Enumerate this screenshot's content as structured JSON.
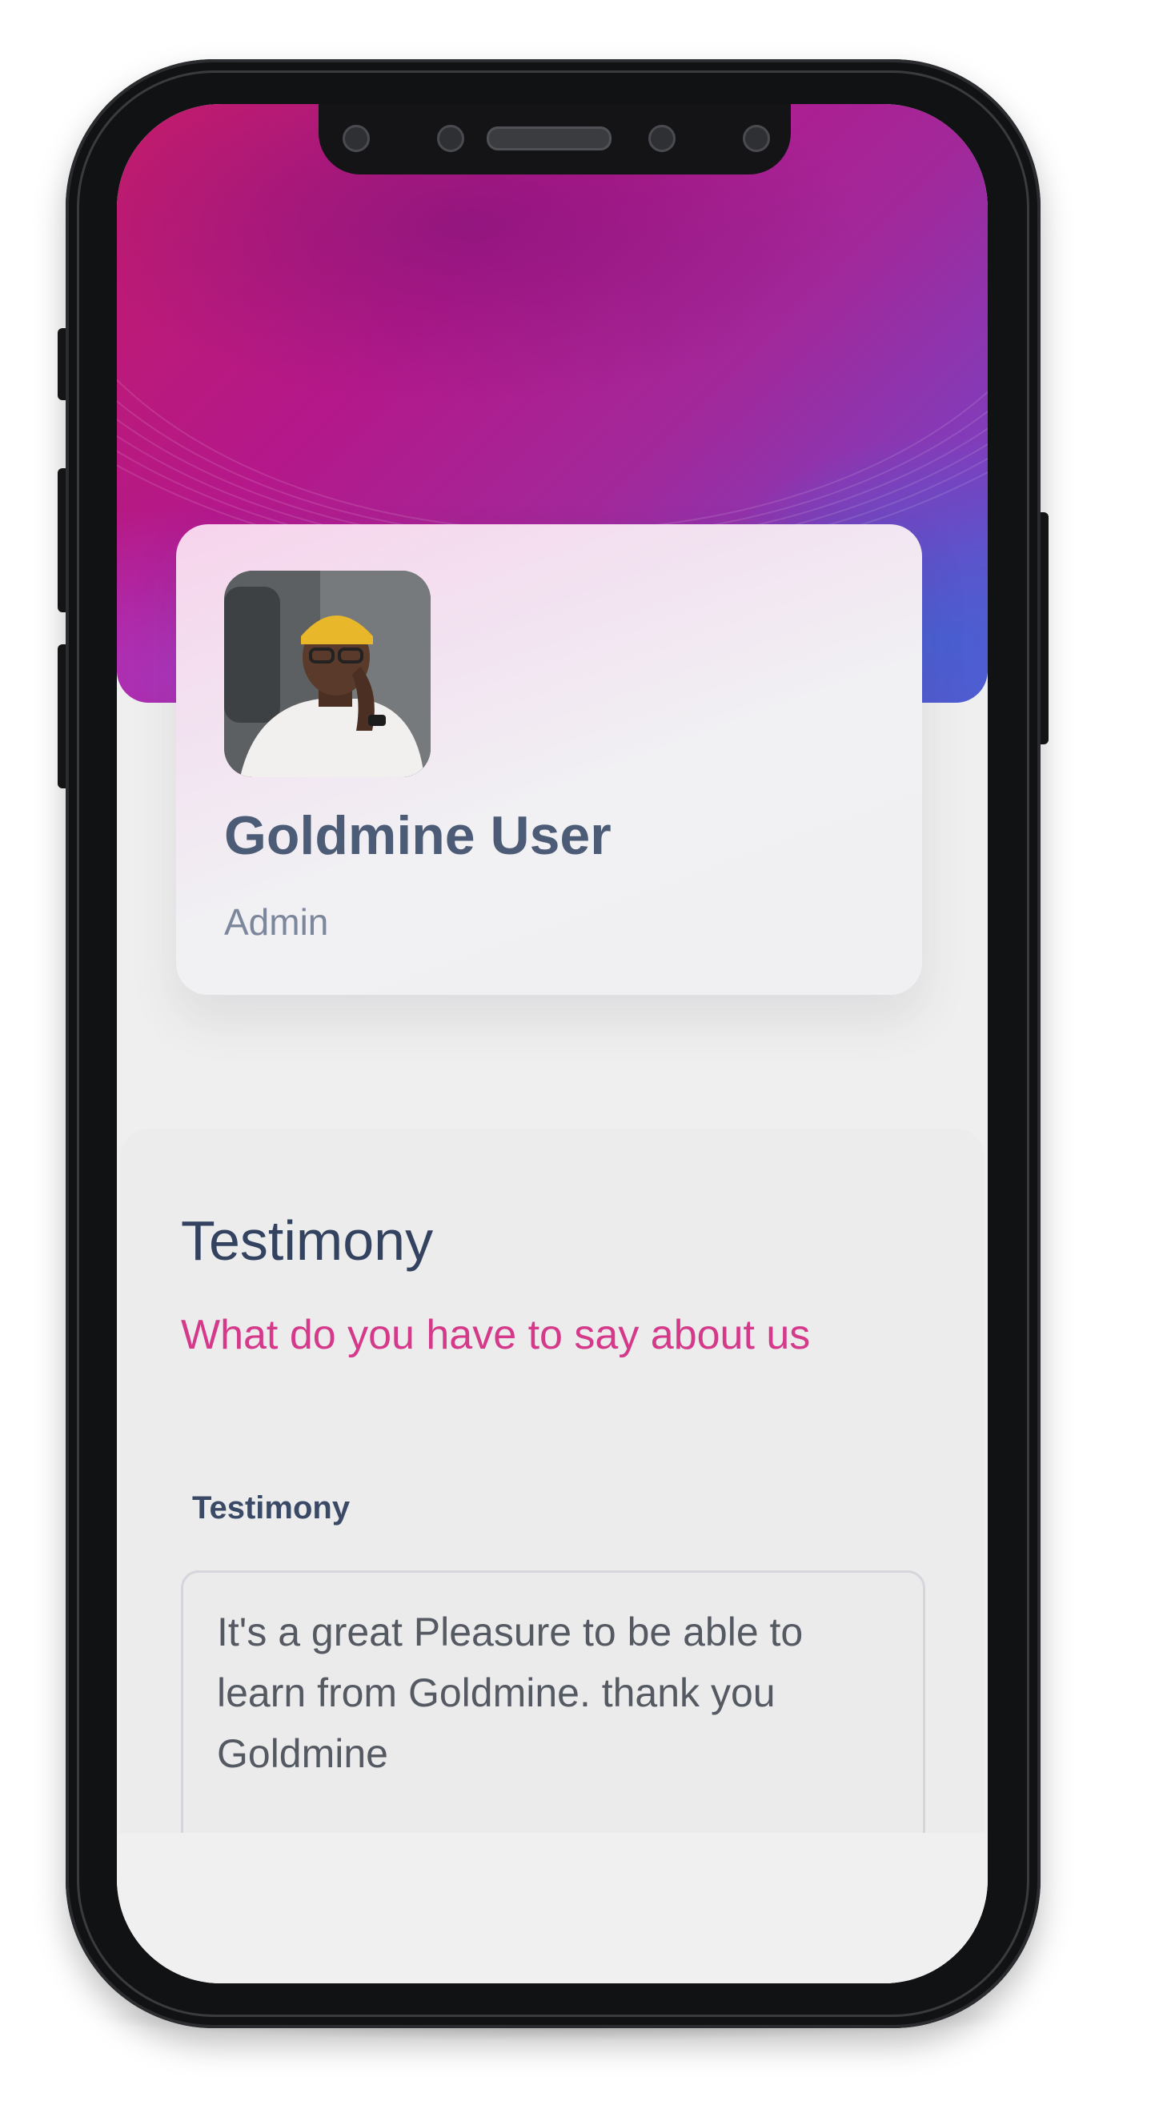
{
  "profile": {
    "name": "Goldmine User",
    "role": "Admin"
  },
  "testimony_section": {
    "title": "Testimony",
    "subtitle": "What do you have to say about us",
    "field_label": "Testimony",
    "field_value": "It's a great Pleasure to be able to learn from Goldmine. thank you Goldmine"
  },
  "colors": {
    "accent_pink": "#d4398a",
    "title_navy": "#33425f",
    "name_slate": "#4d5c76"
  }
}
